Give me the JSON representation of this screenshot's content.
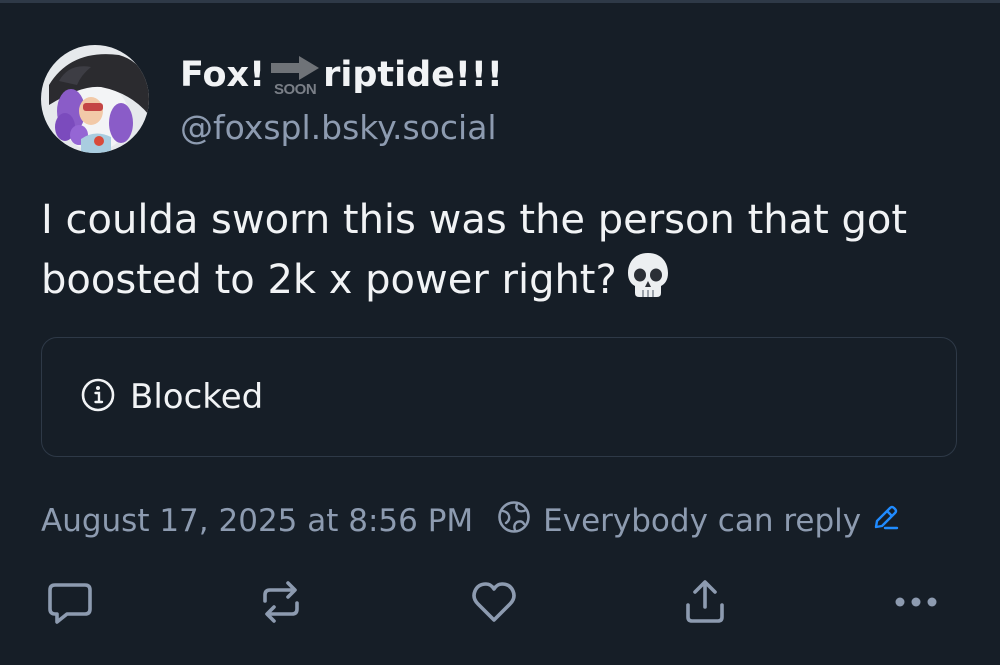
{
  "author": {
    "display_name_part1": "Fox!",
    "arrow_badge_text": "SOON",
    "display_name_part2": "riptide!!!",
    "handle": "@foxspl.bsky.social"
  },
  "post": {
    "text": "I coulda sworn this was the person that got boosted to 2k x power right?",
    "emoji": "💀",
    "embed_label": "Blocked",
    "timestamp": "August 17, 2025 at 8:56 PM",
    "reply_setting": "Everybody can reply"
  },
  "actions": [
    {
      "name": "reply",
      "icon": "speech-bubble-icon"
    },
    {
      "name": "repost",
      "icon": "repost-icon"
    },
    {
      "name": "like",
      "icon": "heart-icon"
    },
    {
      "name": "share",
      "icon": "share-icon"
    },
    {
      "name": "more",
      "icon": "ellipsis-icon"
    }
  ],
  "colors": {
    "background": "#161e27",
    "primary_text": "#f1f3f5",
    "secondary_text": "#8d9bb0",
    "border": "#2e3947",
    "accent": "#208bfe"
  }
}
